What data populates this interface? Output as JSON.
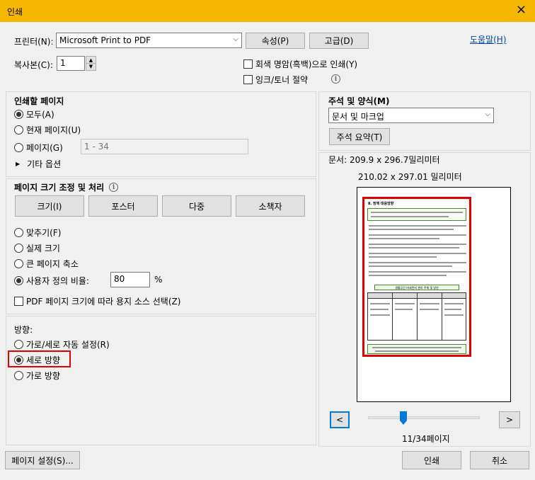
{
  "window": {
    "title": "인쇄",
    "close_icon": "×"
  },
  "printer": {
    "label": "프린터(N):",
    "selected": "Microsoft Print to PDF",
    "properties_label": "속성(P)",
    "advanced_label": "고급(D)",
    "help_label": "도움말(H)"
  },
  "copies": {
    "label": "복사본(C):",
    "value": "1"
  },
  "options": {
    "grayscale_label": "회색 명암(흑백)으로 인쇄(Y)",
    "save_ink_label": "잉크/토너 절약"
  },
  "pages_to_print": {
    "heading": "인쇄할 페이지",
    "all_label": "모두(A)",
    "current_label": "현재 페이지(U)",
    "pages_label": "페이지(G)",
    "pages_value": "1 - 34",
    "more_options_label": "기타 옵션"
  },
  "sizing": {
    "heading": "페이지 크기 조정 및 처리",
    "tabs": [
      "크기(I)",
      "포스터",
      "다중",
      "소책자"
    ],
    "fit_label": "맞추기(F)",
    "actual_label": "실제 크기",
    "shrink_label": "큰 페이지 축소",
    "custom_label": "사용자 정의 비율:",
    "custom_value": "80",
    "percent": "%",
    "pdf_source_label": "PDF 페이지 크기에 따라 용지 소스 선택(Z)"
  },
  "orientation": {
    "heading": "방향:",
    "auto_label": "가로/세로 자동 설정(R)",
    "portrait_label": "세로 방향",
    "landscape_label": "가로 방향"
  },
  "comments": {
    "heading": "주석 및 양식(M)",
    "selected": "문서 및 마크업",
    "summary_label": "주석 요약(T)"
  },
  "preview": {
    "doc_size": "문서: 209.9 x 296.7밀리미터",
    "paper_size": "210.02 x 297.01 밀리미터",
    "prev_label": "<",
    "next_label": ">",
    "page_indicator": "11/34페이지",
    "current_page": 11,
    "total_pages": 34,
    "doc_heading": "Ⅱ. 정책 대응방향",
    "doc_box_title": "생활공간 미세먼지 관리 주체 및 방안"
  },
  "footer": {
    "page_setup_label": "페이지 설정(S)...",
    "print_label": "인쇄",
    "cancel_label": "취소"
  },
  "colors": {
    "title_bar": "#f6b700",
    "highlight": "#e00000",
    "link": "#0045a0"
  }
}
